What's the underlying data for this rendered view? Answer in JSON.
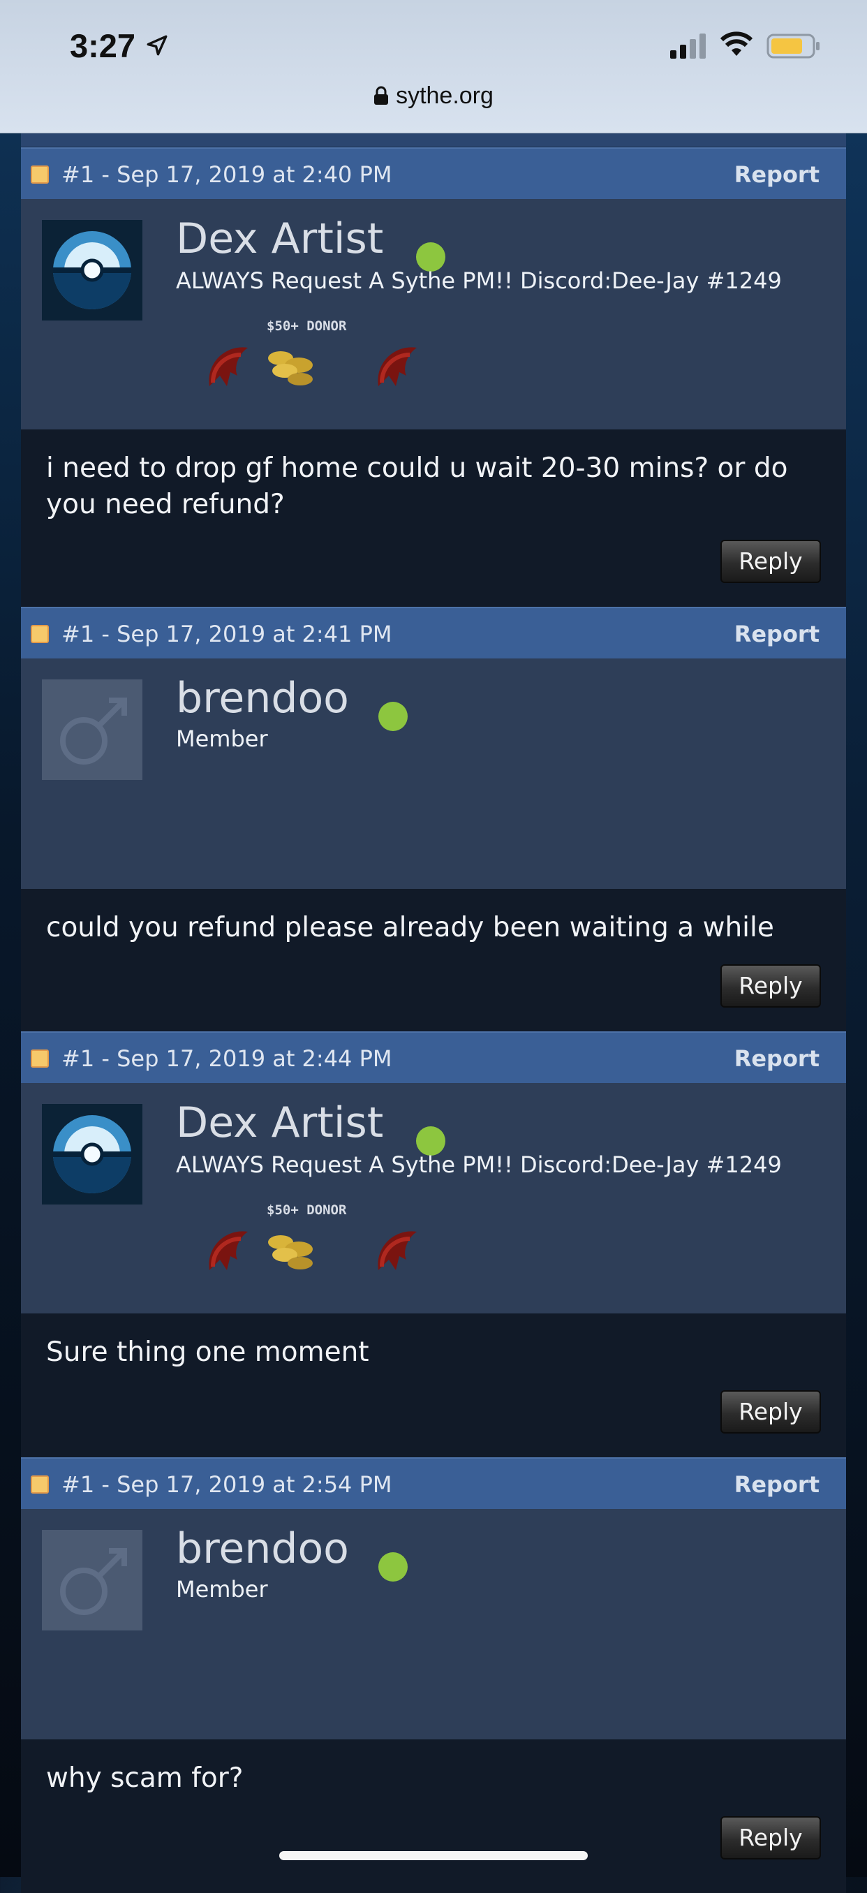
{
  "status_bar": {
    "time": "3:27",
    "url": "sythe.org"
  },
  "donor_badge": {
    "label": "$50+ DONOR"
  },
  "posts": [
    {
      "meta": "#1 - Sep 17, 2019 at 2:40 PM",
      "report": "Report",
      "username": "Dex Artist",
      "user_title": "ALWAYS Request A Sythe PM!! Discord:Dee-Jay #1249",
      "message": "i need to drop gf home could u wait 20-30 mins? or do you need refund?",
      "reply": "Reply"
    },
    {
      "meta": "#1 - Sep 17, 2019 at 2:41 PM",
      "report": "Report",
      "username": "brendoo",
      "user_title": "Member",
      "message": "could you refund please already been waiting a while",
      "reply": "Reply"
    },
    {
      "meta": "#1 - Sep 17, 2019 at 2:44 PM",
      "report": "Report",
      "username": "Dex Artist",
      "user_title": "ALWAYS Request A Sythe PM!! Discord:Dee-Jay #1249",
      "message": "Sure thing one moment",
      "reply": "Reply"
    },
    {
      "meta": "#1 - Sep 17, 2019 at 2:54 PM",
      "report": "Report",
      "username": "brendoo",
      "user_title": "Member",
      "message": "why scam for?",
      "reply": "Reply"
    }
  ],
  "colors": {
    "header": "#3a5f96",
    "user_area": "#2e3e58",
    "message_bg": "#111a28",
    "online": "#8dc63f"
  }
}
